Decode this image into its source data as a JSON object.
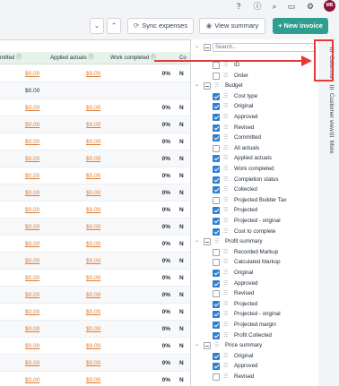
{
  "toolbar": {
    "sync_label": "Sync expenses",
    "view_summary_label": "View summary",
    "new_invoice_label": "+ New invoice",
    "avatar_initials": "MB"
  },
  "table": {
    "headers": [
      "mitted ⓘ",
      "Applied actuals ⓘ",
      "Work completed ⓘ",
      "Co"
    ],
    "rows": [
      {
        "committed": "$0.00",
        "applied": "$0.00",
        "pct": "0%",
        "status": "N"
      },
      {
        "committed": "",
        "applied": "$0.00",
        "pct": "",
        "status": ""
      },
      {
        "committed": "$0.00",
        "applied": "$0.00",
        "pct": "0%",
        "status": "N"
      },
      {
        "committed": "$0.00",
        "applied": "$0.00",
        "pct": "0%",
        "status": "N"
      },
      {
        "committed": "$0.00",
        "applied": "$0.00",
        "pct": "0%",
        "status": "N"
      },
      {
        "committed": "$0.00",
        "applied": "$0.00",
        "pct": "0%",
        "status": "N"
      },
      {
        "committed": "$0.00",
        "applied": "$0.00",
        "pct": "0%",
        "status": "N"
      },
      {
        "committed": "$0.00",
        "applied": "$0.00",
        "pct": "0%",
        "status": "N"
      },
      {
        "committed": "$0.00",
        "applied": "$0.00",
        "pct": "0%",
        "status": "N"
      },
      {
        "committed": "$0.00",
        "applied": "$0.00",
        "pct": "0%",
        "status": "N"
      },
      {
        "committed": "$0.00",
        "applied": "$0.00",
        "pct": "0%",
        "status": "N"
      },
      {
        "committed": "$0.00",
        "applied": "$0.00",
        "pct": "0%",
        "status": "N"
      },
      {
        "committed": "$0.00",
        "applied": "$0.00",
        "pct": "0%",
        "status": "N"
      },
      {
        "committed": "$0.00",
        "applied": "$0.00",
        "pct": "0%",
        "status": "N"
      },
      {
        "committed": "$0.00",
        "applied": "$0.00",
        "pct": "0%",
        "status": "N"
      },
      {
        "committed": "$0.00",
        "applied": "$0.00",
        "pct": "0%",
        "status": "N"
      },
      {
        "committed": "$0.00",
        "applied": "$0.00",
        "pct": "0%",
        "status": "N"
      },
      {
        "committed": "$0.00",
        "applied": "$0.00",
        "pct": "0%",
        "status": "N"
      },
      {
        "committed": "$0.00",
        "applied": "$0.00",
        "pct": "0%",
        "status": "N"
      }
    ]
  },
  "columns_panel": {
    "search_placeholder": "Search...",
    "items": [
      {
        "label": "ID",
        "level": 1,
        "checked": false,
        "group": false
      },
      {
        "label": "Order",
        "level": 1,
        "checked": false,
        "group": false
      },
      {
        "label": "Budget",
        "level": 0,
        "checked": "partial",
        "group": true
      },
      {
        "label": "Cost type",
        "level": 1,
        "checked": true,
        "group": false
      },
      {
        "label": "Original",
        "level": 1,
        "checked": true,
        "group": false
      },
      {
        "label": "Approved",
        "level": 1,
        "checked": true,
        "group": false
      },
      {
        "label": "Revised",
        "level": 1,
        "checked": true,
        "group": false
      },
      {
        "label": "Committed",
        "level": 1,
        "checked": true,
        "group": false
      },
      {
        "label": "All actuals",
        "level": 1,
        "checked": false,
        "group": false
      },
      {
        "label": "Applied actuals",
        "level": 1,
        "checked": true,
        "group": false
      },
      {
        "label": "Work completed",
        "level": 1,
        "checked": true,
        "group": false
      },
      {
        "label": "Completion status",
        "level": 1,
        "checked": true,
        "group": false
      },
      {
        "label": "Collected",
        "level": 1,
        "checked": true,
        "group": false
      },
      {
        "label": "Projected Builder Tax",
        "level": 1,
        "checked": false,
        "group": false
      },
      {
        "label": "Projected",
        "level": 1,
        "checked": true,
        "group": false
      },
      {
        "label": "Projected - original",
        "level": 1,
        "checked": true,
        "group": false
      },
      {
        "label": "Cost to complete",
        "level": 1,
        "checked": true,
        "group": false
      },
      {
        "label": "Profit summary",
        "level": 0,
        "checked": "partial",
        "group": true
      },
      {
        "label": "Recorded Markup",
        "level": 1,
        "checked": false,
        "group": false
      },
      {
        "label": "Calculated Markup",
        "level": 1,
        "checked": false,
        "group": false
      },
      {
        "label": "Original",
        "level": 1,
        "checked": true,
        "group": false
      },
      {
        "label": "Approved",
        "level": 1,
        "checked": true,
        "group": false
      },
      {
        "label": "Revised",
        "level": 1,
        "checked": false,
        "group": false
      },
      {
        "label": "Projected",
        "level": 1,
        "checked": true,
        "group": false
      },
      {
        "label": "Projected - original",
        "level": 1,
        "checked": true,
        "group": false
      },
      {
        "label": "Projected margin",
        "level": 1,
        "checked": true,
        "group": false
      },
      {
        "label": "Profit Collected",
        "level": 1,
        "checked": true,
        "group": false
      },
      {
        "label": "Price summary",
        "level": 0,
        "checked": "partial",
        "group": true
      },
      {
        "label": "Original",
        "level": 1,
        "checked": true,
        "group": false
      },
      {
        "label": "Approved",
        "level": 1,
        "checked": true,
        "group": false
      },
      {
        "label": "Revised",
        "level": 1,
        "checked": false,
        "group": false
      }
    ]
  },
  "side_tabs": {
    "columns": "Columns",
    "customer_view": "Customer view",
    "more": "More"
  },
  "colors": {
    "accent": "#2f9e8f",
    "money_link": "#e07a2f",
    "checkbox": "#2f7fd1",
    "highlight": "#e53935",
    "header_bg": "#e6f3ea"
  }
}
